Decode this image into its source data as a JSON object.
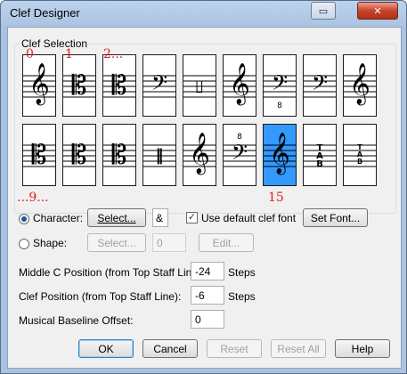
{
  "window": {
    "title": "Clef Designer",
    "restore_icon": "▭",
    "close_icon": "✕"
  },
  "group": {
    "label": "Clef Selection"
  },
  "annotations": [
    "0",
    "1",
    "2...",
    "...9...",
    "15"
  ],
  "clefs_row1": [
    {
      "name": "treble",
      "glyph": "𝄞"
    },
    {
      "name": "alto",
      "glyph": "𝄡"
    },
    {
      "name": "tenor",
      "glyph": "𝄡"
    },
    {
      "name": "bass",
      "glyph": "𝄢"
    },
    {
      "name": "percussion",
      "glyph": "▯"
    },
    {
      "name": "treble-low",
      "glyph": "𝄞"
    },
    {
      "name": "bass-8vb",
      "glyph": "𝄢",
      "sub": "8"
    },
    {
      "name": "bass-high",
      "glyph": "𝄢"
    },
    {
      "name": "treble-high",
      "glyph": "𝄞"
    }
  ],
  "clefs_row2": [
    {
      "name": "c-soprano",
      "glyph": "𝄡"
    },
    {
      "name": "c-mezzo",
      "glyph": "𝄡"
    },
    {
      "name": "c-baritone",
      "glyph": "𝄡"
    },
    {
      "name": "percussion-2",
      "glyph": "‖"
    },
    {
      "name": "treble-2",
      "glyph": "𝄞"
    },
    {
      "name": "bass-8va",
      "glyph": "𝄢",
      "sup": "8"
    },
    {
      "name": "treble-selected",
      "glyph": "𝄞"
    },
    {
      "name": "tab",
      "glyph": "T\nA\nB"
    },
    {
      "name": "tab-small",
      "glyph": "T\nA\nB"
    }
  ],
  "character": {
    "radio_label": "Character:",
    "select_button": "Select...",
    "value": "&",
    "use_default_label": "Use default clef font",
    "set_font_button": "Set Font..."
  },
  "shape": {
    "radio_label": "Shape:",
    "select_button": "Select...",
    "value": "0",
    "edit_button": "Edit..."
  },
  "params": {
    "middle_c_label": "Middle C Position (from Top Staff Line):",
    "middle_c_value": "-24",
    "middle_c_unit": "Steps",
    "clef_pos_label": "Clef Position (from Top Staff Line):",
    "clef_pos_value": "-6",
    "clef_pos_unit": "Steps",
    "baseline_label": "Musical Baseline Offset:",
    "baseline_value": "0"
  },
  "buttons": {
    "ok": "OK",
    "cancel": "Cancel",
    "reset": "Reset",
    "reset_all": "Reset All",
    "help": "Help"
  }
}
